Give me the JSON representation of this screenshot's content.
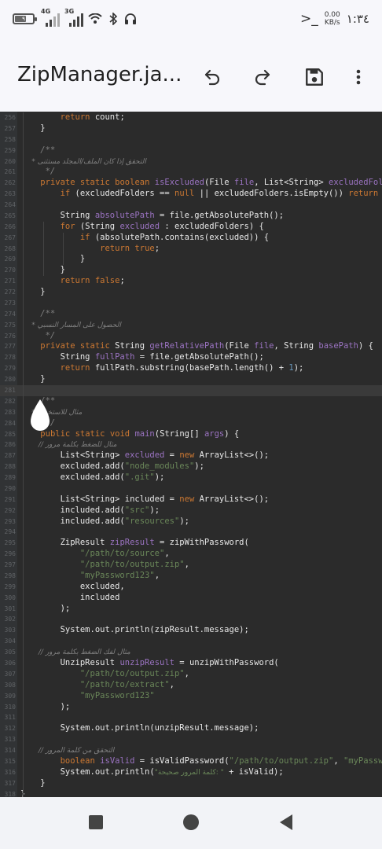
{
  "status_bar": {
    "battery": "٩",
    "network_1": "4G",
    "network_2": "3G",
    "speed_value": "0.00",
    "speed_unit": "KB/s",
    "time": "١:٣٤",
    "icons": [
      "wifi-icon",
      "bluetooth-icon",
      "headset-icon",
      "terminal-icon"
    ]
  },
  "toolbar": {
    "title": "ZipManager.ja...",
    "undo_icon": "undo-icon",
    "redo_icon": "redo-icon",
    "save_icon": "save-icon",
    "more_icon": "more-vert-icon"
  },
  "editor": {
    "lines": [
      {
        "n": "256",
        "t": "        return count;"
      },
      {
        "n": "257",
        "t": "    }"
      },
      {
        "n": "258",
        "t": ""
      },
      {
        "n": "259",
        "t": "    /**"
      },
      {
        "n": "260",
        "t": "     * التحقق إذا كان الملف/المجلد مستثنى"
      },
      {
        "n": "261",
        "t": "     */"
      },
      {
        "n": "262",
        "t": "    private static boolean isExcluded(File file, List<String> excludedFol"
      },
      {
        "n": "263",
        "t": "        if (excludedFolders == null || excludedFolders.isEmpty()) return"
      },
      {
        "n": "264",
        "t": ""
      },
      {
        "n": "265",
        "t": "        String absolutePath = file.getAbsolutePath();"
      },
      {
        "n": "266",
        "t": "        for (String excluded : excludedFolders) {"
      },
      {
        "n": "267",
        "t": "            if (absolutePath.contains(excluded)) {"
      },
      {
        "n": "268",
        "t": "                return true;"
      },
      {
        "n": "269",
        "t": "            }"
      },
      {
        "n": "270",
        "t": "        }"
      },
      {
        "n": "271",
        "t": "        return false;"
      },
      {
        "n": "272",
        "t": "    }"
      },
      {
        "n": "273",
        "t": ""
      },
      {
        "n": "274",
        "t": "    /**"
      },
      {
        "n": "275",
        "t": "     * الحصول على المسار النسبي"
      },
      {
        "n": "276",
        "t": "     */"
      },
      {
        "n": "277",
        "t": "    private static String getRelativePath(File file, String basePath) {"
      },
      {
        "n": "278",
        "t": "        String fullPath = file.getAbsolutePath();"
      },
      {
        "n": "279",
        "t": "        return fullPath.substring(basePath.length() + 1);"
      },
      {
        "n": "280",
        "t": "    }"
      },
      {
        "n": "281",
        "t": ""
      },
      {
        "n": "282",
        "t": "    /**"
      },
      {
        "n": "283",
        "t": "     * مثال للاستخدام"
      },
      {
        "n": "284",
        "t": "     */"
      },
      {
        "n": "285",
        "t": "    public static void main(String[] args) {"
      },
      {
        "n": "286",
        "t": "        // مثال للضغط بكلمة مرور"
      },
      {
        "n": "287",
        "t": "        List<String> excluded = new ArrayList<>();"
      },
      {
        "n": "288",
        "t": "        excluded.add(\"node_modules\");"
      },
      {
        "n": "289",
        "t": "        excluded.add(\".git\");"
      },
      {
        "n": "290",
        "t": ""
      },
      {
        "n": "291",
        "t": "        List<String> included = new ArrayList<>();"
      },
      {
        "n": "292",
        "t": "        included.add(\"src\");"
      },
      {
        "n": "293",
        "t": "        included.add(\"resources\");"
      },
      {
        "n": "294",
        "t": ""
      },
      {
        "n": "295",
        "t": "        ZipResult zipResult = zipWithPassword("
      },
      {
        "n": "296",
        "t": "            \"/path/to/source\","
      },
      {
        "n": "297",
        "t": "            \"/path/to/output.zip\","
      },
      {
        "n": "298",
        "t": "            \"myPassword123\","
      },
      {
        "n": "299",
        "t": "            excluded,"
      },
      {
        "n": "300",
        "t": "            included"
      },
      {
        "n": "301",
        "t": "        );"
      },
      {
        "n": "302",
        "t": ""
      },
      {
        "n": "303",
        "t": "        System.out.println(zipResult.message);"
      },
      {
        "n": "304",
        "t": ""
      },
      {
        "n": "305",
        "t": "        // مثال لفك الضغط بكلمة مرور"
      },
      {
        "n": "306",
        "t": "        UnzipResult unzipResult = unzipWithPassword("
      },
      {
        "n": "307",
        "t": "            \"/path/to/output.zip\","
      },
      {
        "n": "308",
        "t": "            \"/path/to/extract\","
      },
      {
        "n": "309",
        "t": "            \"myPassword123\""
      },
      {
        "n": "310",
        "t": "        );"
      },
      {
        "n": "311",
        "t": ""
      },
      {
        "n": "312",
        "t": "        System.out.println(unzipResult.message);"
      },
      {
        "n": "313",
        "t": ""
      },
      {
        "n": "314",
        "t": "        // التحقق من كلمة المرور"
      },
      {
        "n": "315",
        "t": "        boolean isValid = isValidPassword(\"/path/to/output.zip\", \"myPassw"
      },
      {
        "n": "316",
        "t": "        System.out.println(\"كلمة المرور صحيحة: \" + isValid);"
      },
      {
        "n": "317",
        "t": "    }"
      },
      {
        "n": "318",
        "t": "}"
      }
    ],
    "current_line": "281",
    "colors": {
      "background": "#2b2b2b",
      "keyword": "#cc7832",
      "function": "#9b73c2",
      "string": "#6a8759",
      "number": "#6897bb",
      "comment": "#808080"
    }
  },
  "nav_bar": {
    "recents_icon": "square-recents-icon",
    "home_icon": "circle-home-icon",
    "back_icon": "triangle-back-icon"
  }
}
